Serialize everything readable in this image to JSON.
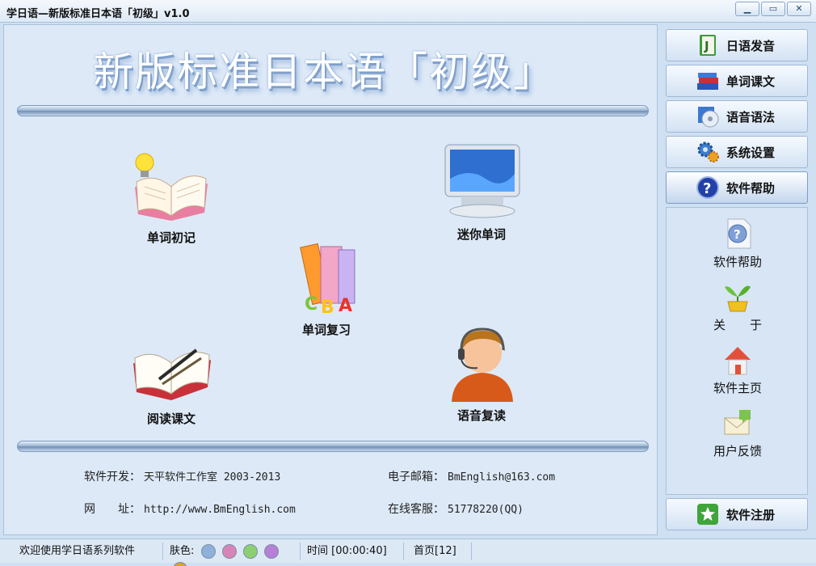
{
  "window": {
    "title": "学日语—新版标准日本语「初级」v1.0",
    "controls": [
      "▁",
      "▭",
      "✕"
    ]
  },
  "main": {
    "heading": "新版标准日本语「初级」",
    "features": [
      {
        "label": "单词初记",
        "icon": "open-book-lightbulb-icon"
      },
      {
        "label": "迷你单词",
        "icon": "monitor-icon"
      },
      {
        "label": "单词复习",
        "icon": "abc-books-icon"
      },
      {
        "label": "阅读课文",
        "icon": "book-pen-icon"
      },
      {
        "label": "语音复读",
        "icon": "headset-agent-icon"
      }
    ],
    "footer": {
      "dev_label": "软件开发：",
      "dev_value": "天平软件工作室 2003-2013",
      "email_label": "电子邮箱：",
      "email_value": "BmEnglish@163.com",
      "site_label": "网　　址：",
      "site_value": "http://www.BmEnglish.com",
      "support_label": "在线客服：",
      "support_value": "51778220(QQ)"
    }
  },
  "sidebar": {
    "nav": [
      {
        "label": "日语发音",
        "icon": "j-notebook-icon"
      },
      {
        "label": "单词课文",
        "icon": "books-stack-icon"
      },
      {
        "label": "语音语法",
        "icon": "cd-music-icon"
      },
      {
        "label": "系统设置",
        "icon": "gears-icon"
      },
      {
        "label": "软件帮助",
        "icon": "help-circle-icon",
        "active": true
      }
    ],
    "sub_items": [
      {
        "label": "软件帮助",
        "icon": "help-document-icon"
      },
      {
        "label": "关　　于",
        "icon": "sprout-pot-icon"
      },
      {
        "label": "软件主页",
        "icon": "home-icon"
      },
      {
        "label": "用户反馈",
        "icon": "feedback-envelope-icon"
      }
    ],
    "register": {
      "label": "软件注册",
      "icon": "star-register-icon"
    }
  },
  "status": {
    "welcome": "欢迎使用学日语系列软件",
    "skin_label": "肤色:",
    "skins": [
      "#8fb0d8",
      "#d884b6",
      "#8ccf72",
      "#b77fd6",
      "#d9a22f"
    ],
    "time": "时间 [00:00:40]",
    "page": "首页[12]"
  }
}
